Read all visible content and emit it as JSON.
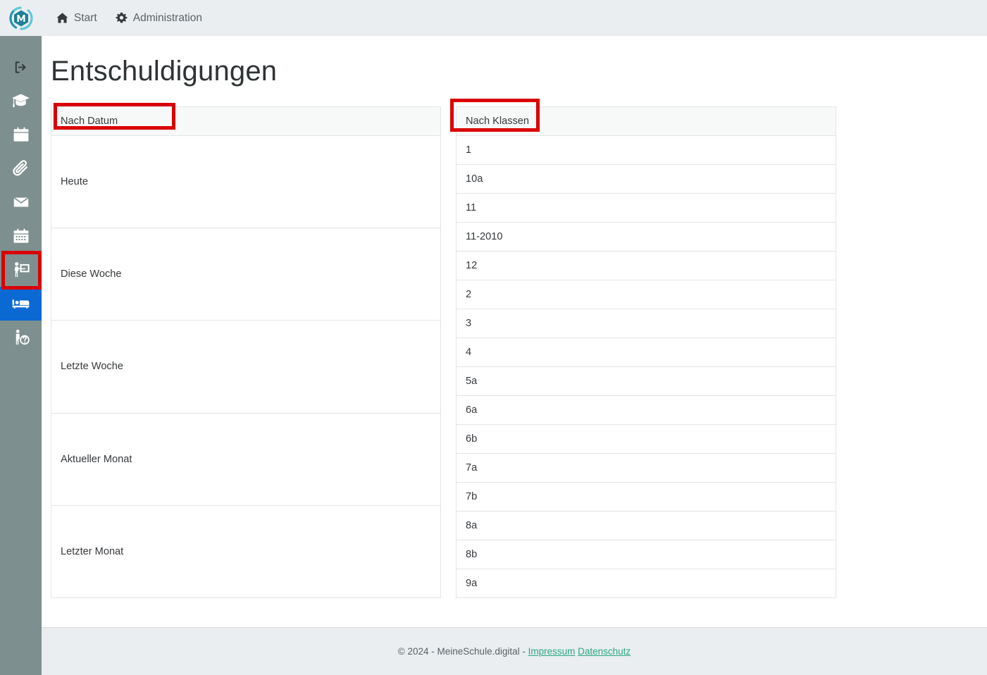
{
  "header": {
    "logo_alt": "MeineSchule.digital Logo",
    "nav": [
      {
        "label": "Start",
        "icon": "home-icon"
      },
      {
        "label": "Administration",
        "icon": "gear-icon"
      }
    ]
  },
  "sidebar": {
    "items": [
      {
        "label": "Abmelden",
        "icon": "sign-out-icon",
        "active": false
      },
      {
        "label": "Schule",
        "icon": "graduation-cap-icon",
        "active": false
      },
      {
        "label": "Kalender",
        "icon": "calendar-blank-icon",
        "active": false
      },
      {
        "label": "Anlagen",
        "icon": "paperclip-icon",
        "active": false
      },
      {
        "label": "Nachrichten",
        "icon": "envelope-icon",
        "active": false
      },
      {
        "label": "Termine",
        "icon": "calendar-days-icon",
        "active": false
      },
      {
        "label": "Unterricht",
        "icon": "chalkboard-teacher-icon",
        "active": false
      },
      {
        "label": "Entschuldigungen",
        "icon": "bed-icon",
        "active": true
      },
      {
        "label": "Hilfe",
        "icon": "person-question-icon",
        "active": false
      }
    ]
  },
  "main": {
    "title": "Entschuldigungen",
    "tables": [
      {
        "name": "nach-datum",
        "header": "Nach Datum",
        "rows": [
          "Heute",
          "Diese Woche",
          "Letzte Woche",
          "Aktueller Monat",
          "Letzter Monat"
        ]
      },
      {
        "name": "nach-klassen",
        "header": "Nach Klassen",
        "rows": [
          "1",
          "10a",
          "11",
          "11-2010",
          "12",
          "2",
          "3",
          "4",
          "5a",
          "6a",
          "6b",
          "7a",
          "7b",
          "8a",
          "8b",
          "9a"
        ]
      }
    ]
  },
  "footer": {
    "copyright": "© 2024 - MeineSchule.digital -",
    "links": [
      {
        "label": "Impressum"
      },
      {
        "label": "Datenschutz"
      }
    ]
  },
  "colors": {
    "sidebar_bg": "#7d8f8e",
    "header_bg": "#eaeef0",
    "active_item": "#0b69d4",
    "annotation": "#d90000",
    "link": "#2aa883",
    "brand_teal": "#2eaab8"
  }
}
